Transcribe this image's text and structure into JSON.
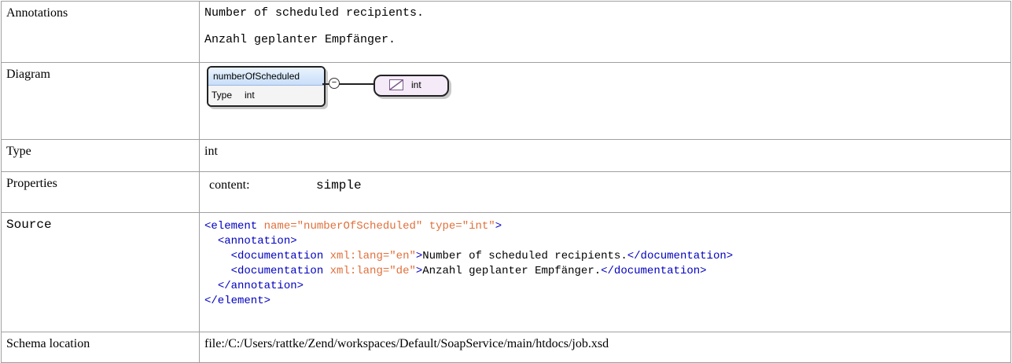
{
  "rows": {
    "annotations": {
      "label": "Annotations",
      "lines": [
        "Number of scheduled recipients.",
        "Anzahl geplanter Empfänger."
      ]
    },
    "diagram": {
      "label": "Diagram",
      "element_name": "numberOfScheduled",
      "type_key": "Type",
      "type_value": "int",
      "target_type": "int"
    },
    "type": {
      "label": "Type",
      "value": "int"
    },
    "properties": {
      "label": "Properties",
      "key": "content:",
      "value": "simple"
    },
    "source": {
      "label": "Source",
      "element_tag_open": "<element",
      "attr_name": "name=",
      "attr_name_val": "\"numberOfScheduled\"",
      "attr_type": "type=",
      "attr_type_val": "\"int\"",
      "annotation_open": "<annotation>",
      "doc_open": "<documentation",
      "xml_lang": "xml:lang=",
      "lang_en": "\"en\"",
      "lang_de": "\"de\"",
      "doc_en_text": "Number of scheduled recipients.",
      "doc_de_text": "Anzahl geplanter Empfänger.",
      "doc_close": "</documentation>",
      "annotation_close": "</annotation>",
      "element_close": "</element>"
    },
    "schema_location": {
      "label": "Schema location",
      "value": "file:/C:/Users/rattke/Zend/workspaces/Default/SoapService/main/htdocs/job.xsd"
    }
  }
}
